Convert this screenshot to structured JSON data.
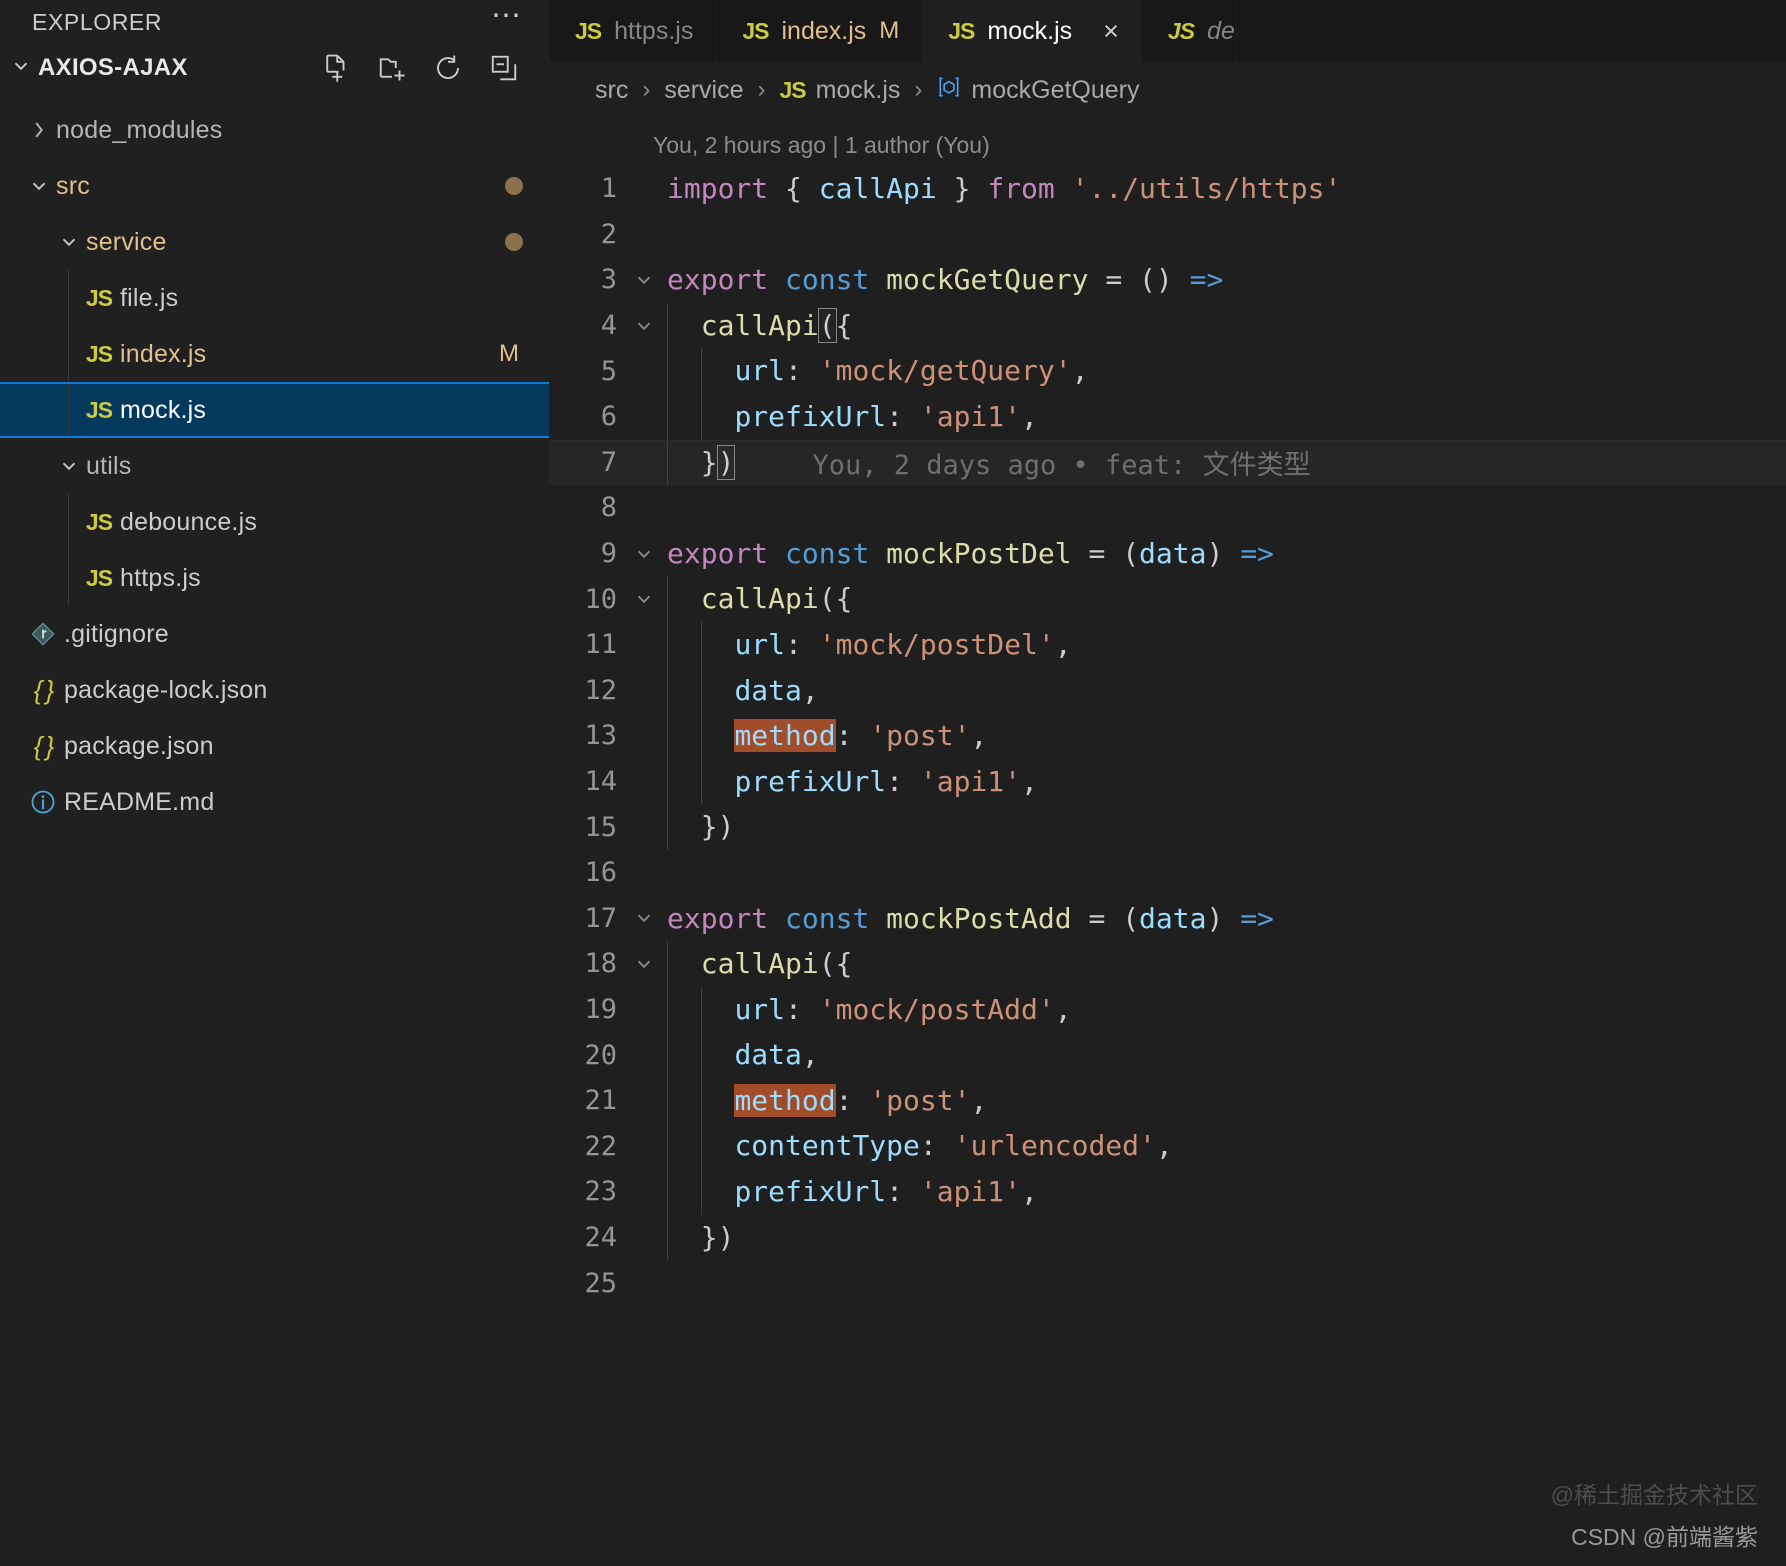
{
  "sidebar": {
    "title": "EXPLORER",
    "overflow_icon": "ellipsis-icon",
    "root": {
      "label": "AXIOS-AJAX",
      "actions": [
        {
          "name": "new-file-icon",
          "tooltip": "New File"
        },
        {
          "name": "new-folder-icon",
          "tooltip": "New Folder"
        },
        {
          "name": "refresh-icon",
          "tooltip": "Refresh Explorer"
        },
        {
          "name": "collapse-all-icon",
          "tooltip": "Collapse Folders in Explorer"
        }
      ]
    },
    "items": [
      {
        "label": "node_modules",
        "type": "folder",
        "state": "collapsed",
        "indent": 1,
        "modified": false,
        "status": ""
      },
      {
        "label": "src",
        "type": "folder",
        "state": "expanded",
        "indent": 1,
        "modified": true,
        "status": "dot"
      },
      {
        "label": "service",
        "type": "folder",
        "state": "expanded",
        "indent": 2,
        "modified": true,
        "status": "dot"
      },
      {
        "label": "file.js",
        "type": "js",
        "indent": 3,
        "modified": false,
        "status": ""
      },
      {
        "label": "index.js",
        "type": "js",
        "indent": 3,
        "modified": true,
        "status": "M"
      },
      {
        "label": "mock.js",
        "type": "js",
        "indent": 3,
        "modified": false,
        "status": "",
        "selected": true
      },
      {
        "label": "utils",
        "type": "folder",
        "state": "expanded",
        "indent": 2,
        "modified": false,
        "status": ""
      },
      {
        "label": "debounce.js",
        "type": "js",
        "indent": 3,
        "modified": false,
        "status": ""
      },
      {
        "label": "https.js",
        "type": "js",
        "indent": 3,
        "modified": false,
        "status": ""
      },
      {
        "label": ".gitignore",
        "type": "git",
        "indent": 1,
        "modified": false,
        "status": ""
      },
      {
        "label": "package-lock.json",
        "type": "json",
        "indent": 1,
        "modified": false,
        "status": ""
      },
      {
        "label": "package.json",
        "type": "json",
        "indent": 1,
        "modified": false,
        "status": ""
      },
      {
        "label": "README.md",
        "type": "info",
        "indent": 1,
        "modified": false,
        "status": ""
      }
    ]
  },
  "tabs": [
    {
      "label": "https.js",
      "icon": "js",
      "active": false,
      "modified": false,
      "dirty_mark": ""
    },
    {
      "label": "index.js",
      "icon": "js",
      "active": false,
      "modified": true,
      "dirty_mark": "M"
    },
    {
      "label": "mock.js",
      "icon": "js",
      "active": true,
      "modified": false,
      "dirty_mark": "",
      "close": "×"
    },
    {
      "label": "de",
      "icon": "js",
      "active": false,
      "modified": false,
      "dirty_mark": "",
      "partial": true
    }
  ],
  "breadcrumb": {
    "parts": [
      "src",
      "service",
      "mock.js",
      "mockGetQuery"
    ],
    "separator": "›",
    "file_icon": "JS",
    "symbol_icon": "[⧉]"
  },
  "editor": {
    "blame_header": "You, 2 hours ago | 1 author (You)",
    "inline_blame": "You, 2 days ago • feat: 文件类型",
    "cursor_line": 7,
    "find_match_text": "method",
    "lines": [
      {
        "n": 1,
        "fold": "",
        "text": "import { callApi } from '../utils/https'"
      },
      {
        "n": 2,
        "fold": "",
        "text": ""
      },
      {
        "n": 3,
        "fold": "down",
        "text": "export const mockGetQuery = () =>"
      },
      {
        "n": 4,
        "fold": "down",
        "text": "  callApi({"
      },
      {
        "n": 5,
        "fold": "",
        "text": "    url: 'mock/getQuery',"
      },
      {
        "n": 6,
        "fold": "",
        "text": "    prefixUrl: 'api1',"
      },
      {
        "n": 7,
        "fold": "",
        "text": "  })"
      },
      {
        "n": 8,
        "fold": "",
        "text": ""
      },
      {
        "n": 9,
        "fold": "down",
        "text": "export const mockPostDel = (data) =>"
      },
      {
        "n": 10,
        "fold": "down",
        "text": "  callApi({"
      },
      {
        "n": 11,
        "fold": "",
        "text": "    url: 'mock/postDel',"
      },
      {
        "n": 12,
        "fold": "",
        "text": "    data,"
      },
      {
        "n": 13,
        "fold": "",
        "text": "    method: 'post',"
      },
      {
        "n": 14,
        "fold": "",
        "text": "    prefixUrl: 'api1',"
      },
      {
        "n": 15,
        "fold": "",
        "text": "  })"
      },
      {
        "n": 16,
        "fold": "",
        "text": ""
      },
      {
        "n": 17,
        "fold": "down",
        "text": "export const mockPostAdd = (data) =>"
      },
      {
        "n": 18,
        "fold": "down",
        "text": "  callApi({"
      },
      {
        "n": 19,
        "fold": "",
        "text": "    url: 'mock/postAdd',"
      },
      {
        "n": 20,
        "fold": "",
        "text": "    data,"
      },
      {
        "n": 21,
        "fold": "",
        "text": "    method: 'post',"
      },
      {
        "n": 22,
        "fold": "",
        "text": "    contentType: 'urlencoded',"
      },
      {
        "n": 23,
        "fold": "",
        "text": "    prefixUrl: 'api1',"
      },
      {
        "n": 24,
        "fold": "",
        "text": "  })"
      },
      {
        "n": 25,
        "fold": "",
        "text": ""
      }
    ]
  },
  "watermarks": {
    "line1": "@稀土掘金技术社区",
    "line2": "CSDN @前端酱紫"
  },
  "colors": {
    "accent_selection": "#04395e",
    "accent_border": "#0a7ad4",
    "modified": "#e2c08d",
    "js_icon": "#cbcb41",
    "find_match": "#a14d2a",
    "bg_editor": "#1f1f1f",
    "bg_sidebar": "#202020",
    "bg_tabbar": "#181818"
  }
}
